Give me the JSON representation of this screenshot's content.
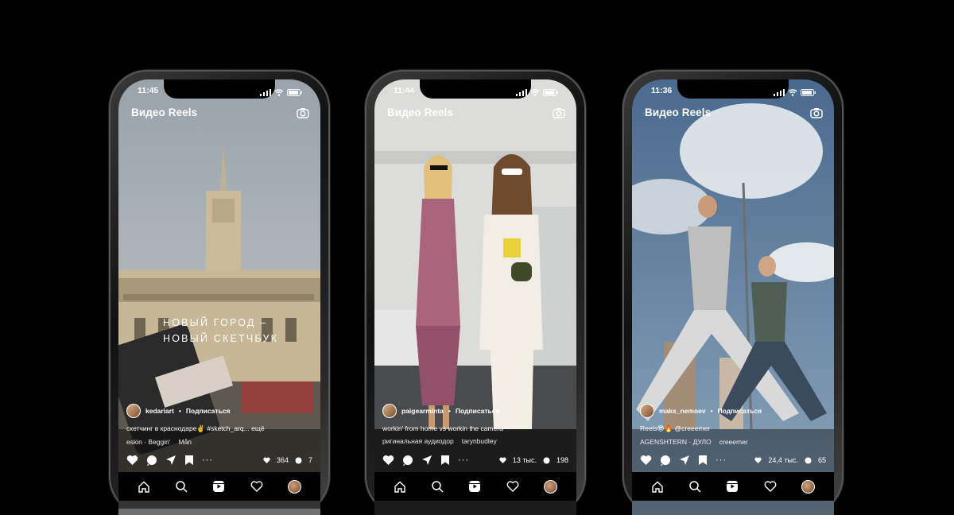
{
  "phones": [
    {
      "time": "11:45",
      "title": "Видео Reels",
      "overlay_line1": "НОВЫЙ ГОРОД –",
      "overlay_line2": "НОВЫЙ СКЕТЧБУК",
      "username": "kedariart",
      "follow": "Подписаться",
      "caption": "скетчинг в краснодаре✌️ #sketch_arq... ещё",
      "music": "eskin · Beggin'",
      "music_extra": "Mån",
      "likes": "364",
      "comments": "7"
    },
    {
      "time": "11:44",
      "title": "Видео Reels",
      "username": "paigearminta",
      "follow": "Подписаться",
      "caption": "workin' from home vs workin the camera",
      "music": "ригинальная аудиодор",
      "music_extra": "tarynbudley",
      "likes": "13 тыс.",
      "comments": "198"
    },
    {
      "time": "11:36",
      "title": "Видео Reels",
      "username": "maks_nemoev",
      "follow": "Подписаться",
      "caption": "Reels😎🔥 @creeemer",
      "music": "AGENSHTERN · ДУЛО",
      "music_extra": "creeemer",
      "likes": "24,4 тыс.",
      "comments": "65"
    }
  ],
  "dot_separator": "•",
  "icons": {
    "camera": "camera-icon",
    "like": "heart-icon",
    "comment": "comment-icon",
    "share": "send-icon",
    "save": "bookmark-icon",
    "more": "more-icon",
    "home": "home-icon",
    "search": "search-icon",
    "reels": "reels-icon",
    "activity": "heart-icon",
    "profile": "profile-avatar"
  }
}
